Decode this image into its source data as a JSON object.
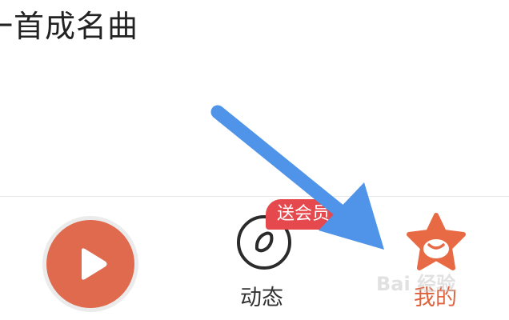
{
  "header": {
    "title": "一首成名曲"
  },
  "bottom_nav": {
    "play_button_icon": "play-icon",
    "dynamic": {
      "label": "动态",
      "icon": "dynamic-circle-icon",
      "badge": "送会员"
    },
    "mine": {
      "label": "我的",
      "icon": "star-face-icon",
      "active": true
    }
  },
  "overlay": {
    "arrow_color": "#4f94e8"
  },
  "watermark": {
    "text": "Bai 经验"
  },
  "colors": {
    "accent": "#e0623c",
    "play": "#e06a4e",
    "badge": "#e5484d"
  }
}
